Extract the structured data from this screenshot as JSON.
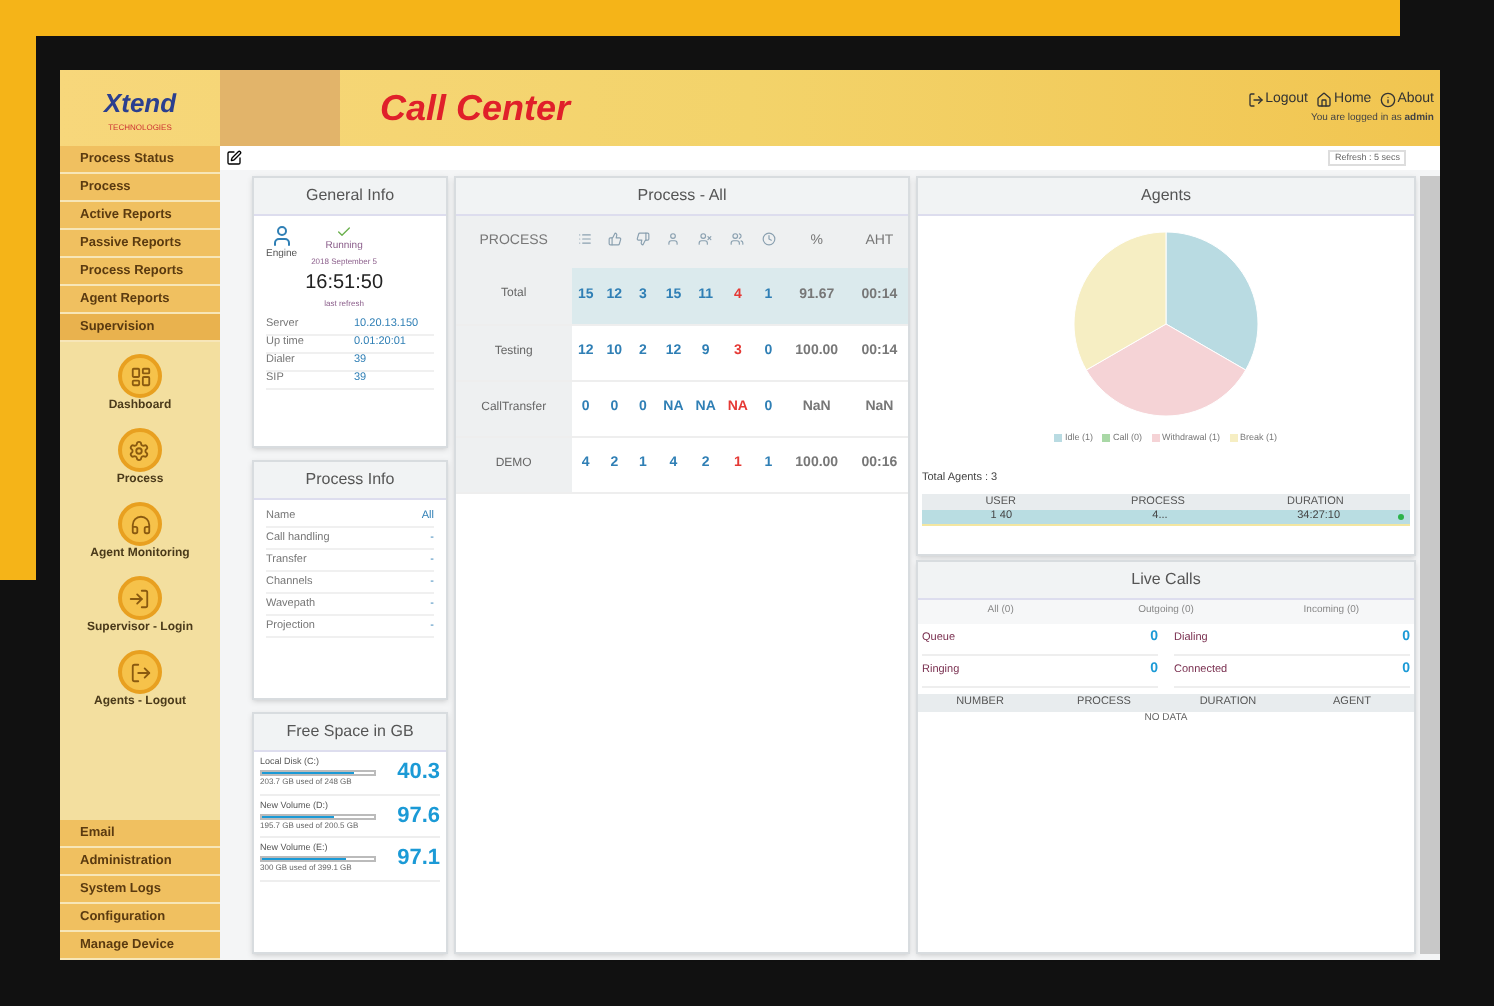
{
  "header": {
    "logo": "Xtend",
    "logo_tagline": "TECHNOLOGIES",
    "title": "Call Center",
    "links": [
      {
        "kind": "logout",
        "label": "Logout"
      },
      {
        "kind": "home",
        "label": "Home"
      },
      {
        "kind": "about",
        "label": "About"
      }
    ],
    "login_note": "You are logged in as **admin**"
  },
  "sidebar": {
    "items": [
      {
        "label": "Process Status",
        "selected": false
      },
      {
        "label": "Process",
        "selected": false
      },
      {
        "label": "Active Reports",
        "selected": false
      },
      {
        "label": "Passive Reports",
        "selected": false
      },
      {
        "label": "Process Reports",
        "selected": false
      },
      {
        "label": "Agent Reports",
        "selected": false
      },
      {
        "label": "Supervision",
        "selected": true,
        "children": [
          {
            "label": "Dashboard"
          },
          {
            "label": "Process"
          },
          {
            "label": "Agent Monitoring"
          },
          {
            "label": "Supervisor - Login"
          },
          {
            "label": "Agents - Logout"
          }
        ]
      }
    ],
    "bottom_items": [
      {
        "label": "Email"
      },
      {
        "label": "Administration"
      },
      {
        "label": "System Logs"
      },
      {
        "label": "Configuration"
      },
      {
        "label": "Manage Device"
      }
    ]
  },
  "toolbar": {
    "refresh": "Refresh : 5 secs"
  },
  "general_info": {
    "title": "General Info",
    "engine_label": "Engine",
    "status": "Running",
    "date": "2018 September 5",
    "time": "16:51:50",
    "time_note": "last refresh",
    "rows": [
      {
        "label": "Server",
        "value": "10.20.13.150"
      },
      {
        "label": "Up time",
        "value": "0.01:20:01"
      },
      {
        "label": "Dialer",
        "value": "39"
      },
      {
        "label": "SIP",
        "value": "39"
      }
    ]
  },
  "process_info": {
    "title": "Process Info",
    "rows": [
      {
        "label": "Name",
        "value": "All"
      },
      {
        "label": "Call handling",
        "value": "-"
      },
      {
        "label": "Transfer",
        "value": "-"
      },
      {
        "label": "Channels",
        "value": "-"
      },
      {
        "label": "Wavepath",
        "value": "-"
      },
      {
        "label": "Projection",
        "value": "-"
      }
    ]
  },
  "free_space": {
    "title": "Free Space in GB",
    "drives": [
      {
        "name": "Local Disk (C:)",
        "value": "40.3",
        "level": 0.83,
        "usage": "203.7 GB used of 248 GB"
      },
      {
        "name": "New Volume (D:)",
        "value": "97.6",
        "level": 0.65,
        "usage": "195.7 GB used of 200.5 GB"
      },
      {
        "name": "New Volume (E:)",
        "value": "97.1",
        "level": 0.75,
        "usage": "300 GB used of 399.1 GB"
      }
    ]
  },
  "process_table": {
    "title": "Process - All",
    "columns": [
      {
        "kind": "label",
        "label": "PROCESS"
      },
      {
        "kind": "icon",
        "color": "#2f7fb5"
      },
      {
        "kind": "icon",
        "color": "#2f7fb5"
      },
      {
        "kind": "icon",
        "color": "#2f7fb5"
      },
      {
        "kind": "icon",
        "color": "#2f7fb5"
      },
      {
        "kind": "icon",
        "color": "#2f7fb5"
      },
      {
        "kind": "icon",
        "color": "#e53935"
      },
      {
        "kind": "icon",
        "color": "#2f7fb5"
      },
      {
        "kind": "label",
        "label": "%"
      },
      {
        "kind": "label",
        "label": "AHT"
      }
    ],
    "rows": [
      {
        "kind": "total",
        "cells": [
          "Total",
          "15",
          "12",
          "3",
          "15",
          "11",
          "4",
          "1",
          "91.67",
          "00:14"
        ]
      },
      {
        "kind": "normal",
        "cells": [
          "Testing",
          "12",
          "10",
          "2",
          "12",
          "9",
          "3",
          "0",
          "100.00",
          "00:14"
        ]
      },
      {
        "kind": "normal",
        "cells": [
          "CallTransfer",
          "0",
          "0",
          "0",
          "NA",
          "NA",
          "NA",
          "0",
          "NaN",
          "NaN"
        ]
      },
      {
        "kind": "normal",
        "cells": [
          "DEMO",
          "4",
          "2",
          "1",
          "4",
          "2",
          "1",
          "1",
          "100.00",
          "00:16"
        ]
      }
    ]
  },
  "agents": {
    "title": "Agents",
    "chart_data": {
      "type": "pie",
      "categories": [
        "Idle (1)",
        "Call (0)",
        "Withdrawal (1)",
        "Break (1)"
      ],
      "values": [
        1,
        0,
        1,
        1
      ],
      "colors": [
        "#b9dbe2",
        "#a9d8a6",
        "#f5d3d6",
        "#f6eec3"
      ]
    },
    "total": "Total Agents : 3",
    "columns": [
      "USER",
      "PROCESS",
      "DURATION"
    ],
    "rows": [
      {
        "cells": [
          "1 40",
          "4...",
          "34:27:10"
        ],
        "selected": true,
        "online": true
      }
    ]
  },
  "live_calls": {
    "title": "Live Calls",
    "tabs": [
      {
        "label": "All (0)",
        "selected": false
      },
      {
        "label": "Outgoing (0)",
        "selected": false
      },
      {
        "label": "Incoming (0)",
        "selected": false
      }
    ],
    "counters": [
      {
        "label": "Queue",
        "value": "0"
      },
      {
        "label": "Dialing",
        "value": "0"
      },
      {
        "label": "Ringing",
        "value": "0"
      },
      {
        "label": "Connected",
        "value": "0"
      }
    ],
    "columns": [
      "NUMBER",
      "PROCESS",
      "DURATION",
      "AGENT"
    ],
    "empty": "NO DATA"
  }
}
